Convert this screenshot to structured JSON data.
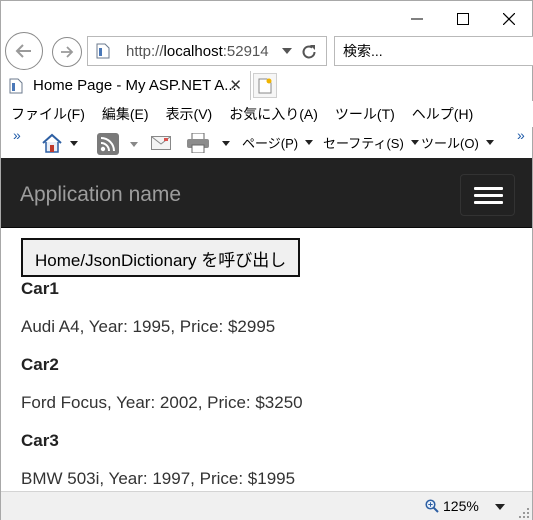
{
  "window": {
    "controls": [
      "minimize",
      "maximize",
      "close"
    ]
  },
  "address_bar": {
    "url_prefix": "http://",
    "url_host": "localhost",
    "url_port": ":52914"
  },
  "search": {
    "placeholder": "検索..."
  },
  "tab": {
    "title": "Home Page - My ASP.NET A...",
    "close": "✕"
  },
  "menu": [
    {
      "label": "ファイル(F)"
    },
    {
      "label": "編集(E)"
    },
    {
      "label": "表示(V)"
    },
    {
      "label": "お気に入り(A)"
    },
    {
      "label": "ツール(T)"
    },
    {
      "label": "ヘルプ(H)"
    }
  ],
  "command_bar": {
    "chevron_left": "»",
    "chevron_right": "»",
    "page_label": "ページ(P)",
    "safety_label": "セーフティ(S)",
    "tools_label": "ツール(O)"
  },
  "site": {
    "brand": "Application name",
    "call_button": "Home/JsonDictionary を呼び出し",
    "cars": [
      {
        "name": "Car1",
        "desc": "Audi A4, Year: 1995, Price: $2995"
      },
      {
        "name": "Car2",
        "desc": "Ford Focus, Year: 2002, Price: $3250"
      },
      {
        "name": "Car3",
        "desc": "BMW 503i, Year: 1997, Price: $1995"
      }
    ]
  },
  "status": {
    "zoom": "125%"
  },
  "colors": {
    "navbar": "#222222",
    "brand_text": "#9d9d9d",
    "link_chevron": "#1e5aa8",
    "statusbar": "#f0f0f0"
  }
}
